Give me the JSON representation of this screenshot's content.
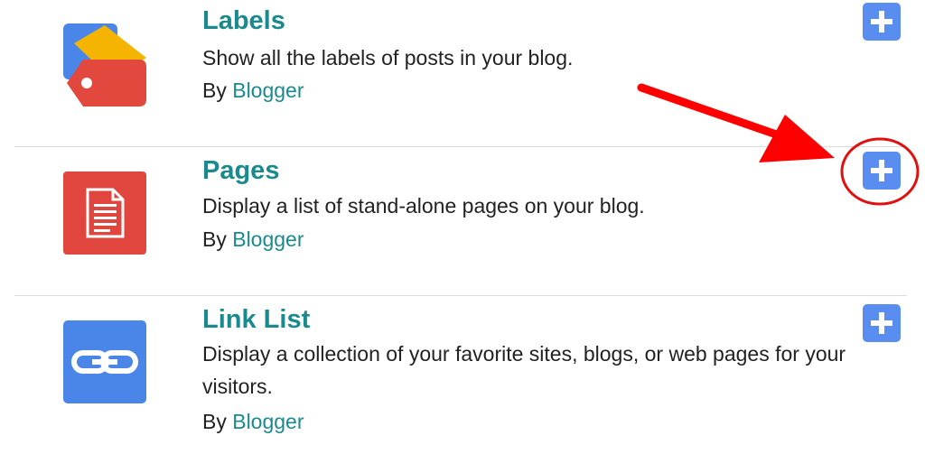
{
  "gadgets": [
    {
      "title": "Labels",
      "description": "Show all the labels of posts in your blog.",
      "byline_prefix": "By ",
      "author": "Blogger",
      "icon": "label-tag-icon",
      "add_icon": "plus-icon"
    },
    {
      "title": "Pages",
      "description": "Display a list of stand-alone pages on your blog.",
      "byline_prefix": "By ",
      "author": "Blogger",
      "icon": "page-document-icon",
      "add_icon": "plus-icon",
      "highlighted": true
    },
    {
      "title": "Link List",
      "description": "Display a collection of your favorite sites, blogs, or web pages for your visitors.",
      "byline_prefix": "By ",
      "author": "Blogger",
      "icon": "chain-link-icon",
      "add_icon": "plus-icon"
    }
  ],
  "annotation": {
    "arrow_color": "#ff0000",
    "circle_color": "#e01010",
    "points_to": "Pages add button"
  },
  "colors": {
    "title": "#1a8a8e",
    "author_link": "#1a8a8e",
    "add_button": "#5a8df0",
    "labels_icon_blue": "#4a86e8",
    "labels_icon_yellow": "#f4b400",
    "labels_icon_red": "#e2483d",
    "pages_icon": "#e0463e",
    "linklist_icon": "#4a86e8"
  }
}
